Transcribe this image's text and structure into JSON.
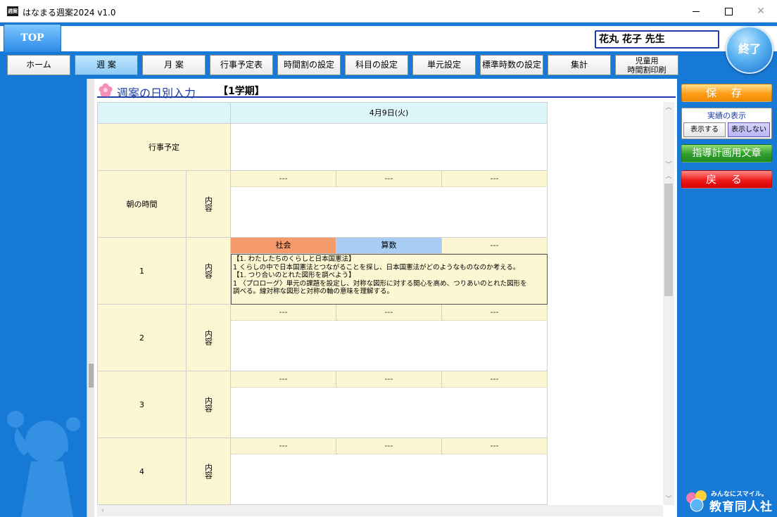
{
  "window": {
    "title": "はなまる週案2024 v1.0",
    "icon_label": "週案"
  },
  "header": {
    "top_tab": "TOP",
    "teacher_name": "花丸 花子 先生",
    "exit_label": "終了"
  },
  "nav": [
    {
      "label": "ホーム"
    },
    {
      "label": "週 案"
    },
    {
      "label": "月 案"
    },
    {
      "label": "行事予定表"
    },
    {
      "label": "時間割の設定"
    },
    {
      "label": "科目の設定"
    },
    {
      "label": "単元設定"
    },
    {
      "label": "標準時数の設定"
    },
    {
      "label": "集計"
    },
    {
      "label_line1": "児童用",
      "label_line2": "時間割印刷"
    }
  ],
  "main": {
    "heading": "週案の日別入力",
    "term": "【1学期】",
    "date": "4月9日(火)",
    "event_label": "行事予定",
    "content_label": "内容",
    "rows": [
      {
        "period": "朝の時間",
        "subjects": [
          "---",
          "---",
          "---"
        ],
        "content": ""
      },
      {
        "period": "1",
        "subjects": [
          "社会",
          "算数",
          "---"
        ],
        "content_lines": [
          "【1. わたしたちのくらしと日本国憲法】",
          "1 くらしの中で日本国憲法とつながることを探し、日本国憲法がどのようなものなのか考える。",
          "【1. つり合いのとれた図形を調べよう】",
          "1 〈プロローグ〉単元の課題を設定し、対称な図形に対する関心を高め、つりあいのとれた図形を",
          "調べる。線対称な図形と対称の軸の意味を理解する。"
        ]
      },
      {
        "period": "2",
        "subjects": [
          "---",
          "---",
          "---"
        ],
        "content": ""
      },
      {
        "period": "3",
        "subjects": [
          "---",
          "---",
          "---"
        ],
        "content": ""
      },
      {
        "period": "4",
        "subjects": [
          "---",
          "---",
          "---"
        ],
        "content": ""
      }
    ]
  },
  "right": {
    "save": "保 存",
    "actual_title": "実績の表示",
    "show": "表示する",
    "hide": "表示しない",
    "plan_text": "指導計画用文章",
    "back": "戻 る",
    "logo_tag": "みんなにスマイル。",
    "logo_brand": "教育同人社"
  },
  "colors": {
    "frame": "#1779d6",
    "social": "#f59a6b",
    "math": "#a7cdf5",
    "cream": "#fdf6d3",
    "date_header": "#dcf6fa"
  }
}
